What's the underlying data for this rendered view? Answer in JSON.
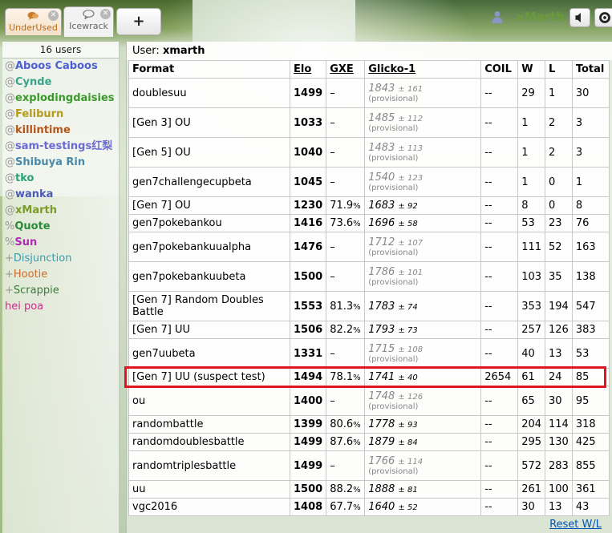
{
  "header": {
    "tabs": [
      {
        "label": "UnderUsed",
        "icon": "chat-bubbles-icon"
      },
      {
        "label": "Icewrack",
        "icon": "chat-bubble-icon"
      }
    ],
    "new_tab_label": "+",
    "username": "xMarth"
  },
  "users": {
    "count_label": "16 users",
    "items": [
      {
        "rank": "@",
        "name": "Aboos Caboos",
        "color": "#4d5fd3",
        "bold": true
      },
      {
        "rank": "@",
        "name": "Cynde",
        "color": "#3aa38a",
        "bold": true
      },
      {
        "rank": "@",
        "name": "explodingdaisies",
        "color": "#3a9a2a",
        "bold": true
      },
      {
        "rank": "@",
        "name": "Feliburn",
        "color": "#b59a1c",
        "bold": true
      },
      {
        "rank": "@",
        "name": "killintime",
        "color": "#b4551a",
        "bold": true
      },
      {
        "rank": "@",
        "name": "sam-testings红梨",
        "color": "#6a6ad0",
        "bold": true
      },
      {
        "rank": "@",
        "name": "Shibuya Rin",
        "color": "#4a8aa8",
        "bold": true
      },
      {
        "rank": "@",
        "name": "tko",
        "color": "#2aa07a",
        "bold": true
      },
      {
        "rank": "@",
        "name": "wanka",
        "color": "#4a5ab5",
        "bold": true
      },
      {
        "rank": "@",
        "name": "xMarth",
        "color": "#7a9a2a",
        "bold": true
      },
      {
        "rank": "%",
        "name": "Quote",
        "color": "#2a8a3a",
        "bold": true
      },
      {
        "rank": "%",
        "name": "Sun",
        "color": "#b02ab5",
        "bold": true
      },
      {
        "rank": "+",
        "name": "Disjunction",
        "color": "#3a9ab0",
        "bold": false
      },
      {
        "rank": "+",
        "name": "Hootie",
        "color": "#d06a2a",
        "bold": false
      },
      {
        "rank": "+",
        "name": "Scrappie",
        "color": "#3a7a3a",
        "bold": false
      },
      {
        "rank": "",
        "name": "hei poa",
        "color": "#d02a8a",
        "bold": false
      }
    ]
  },
  "main": {
    "user_label": "User:",
    "user_value": "xmarth",
    "columns": [
      "Format",
      "Elo",
      "GXE",
      "Glicko-1",
      "COIL",
      "W",
      "L",
      "Total"
    ],
    "provisional_label": "(provisional)",
    "rows": [
      {
        "format": "doublesuu",
        "elo": "1499",
        "gxe": "–",
        "gl": "1843",
        "rd": "± 161",
        "prov": true,
        "coil": "--",
        "w": "29",
        "l": "1",
        "total": "30"
      },
      {
        "format": "[Gen 3] OU",
        "elo": "1033",
        "gxe": "–",
        "gl": "1485",
        "rd": "± 112",
        "prov": true,
        "coil": "--",
        "w": "1",
        "l": "2",
        "total": "3"
      },
      {
        "format": "[Gen 5] OU",
        "elo": "1040",
        "gxe": "–",
        "gl": "1483",
        "rd": "± 113",
        "prov": true,
        "coil": "--",
        "w": "1",
        "l": "2",
        "total": "3"
      },
      {
        "format": "gen7challengecupbeta",
        "elo": "1045",
        "gxe": "–",
        "gl": "1540",
        "rd": "± 123",
        "prov": true,
        "coil": "--",
        "w": "1",
        "l": "0",
        "total": "1"
      },
      {
        "format": "[Gen 7] OU",
        "elo": "1230",
        "gxe": "71.9",
        "gl": "1683",
        "rd": "± 92",
        "prov": false,
        "coil": "--",
        "w": "8",
        "l": "0",
        "total": "8"
      },
      {
        "format": "gen7pokebankou",
        "elo": "1416",
        "gxe": "73.6",
        "gl": "1696",
        "rd": "± 58",
        "prov": false,
        "coil": "--",
        "w": "53",
        "l": "23",
        "total": "76"
      },
      {
        "format": "gen7pokebankuualpha",
        "elo": "1476",
        "gxe": "–",
        "gl": "1712",
        "rd": "± 107",
        "prov": true,
        "coil": "--",
        "w": "111",
        "l": "52",
        "total": "163"
      },
      {
        "format": "gen7pokebankuubeta",
        "elo": "1500",
        "gxe": "–",
        "gl": "1786",
        "rd": "± 101",
        "prov": true,
        "coil": "--",
        "w": "103",
        "l": "35",
        "total": "138"
      },
      {
        "format": "[Gen 7] Random Doubles Battle",
        "elo": "1553",
        "gxe": "81.3",
        "gl": "1783",
        "rd": "± 74",
        "prov": false,
        "coil": "--",
        "w": "353",
        "l": "194",
        "total": "547"
      },
      {
        "format": "[Gen 7] UU",
        "elo": "1506",
        "gxe": "82.2",
        "gl": "1793",
        "rd": "± 73",
        "prov": false,
        "coil": "--",
        "w": "257",
        "l": "126",
        "total": "383"
      },
      {
        "format": "gen7uubeta",
        "elo": "1331",
        "gxe": "–",
        "gl": "1715",
        "rd": "± 108",
        "prov": true,
        "coil": "--",
        "w": "40",
        "l": "13",
        "total": "53"
      },
      {
        "format": "[Gen 7] UU (suspect test)",
        "elo": "1494",
        "gxe": "78.1",
        "gl": "1741",
        "rd": "± 40",
        "prov": false,
        "coil": "2654",
        "w": "61",
        "l": "24",
        "total": "85",
        "highlighted": true
      },
      {
        "format": "ou",
        "elo": "1400",
        "gxe": "–",
        "gl": "1748",
        "rd": "± 126",
        "prov": true,
        "coil": "--",
        "w": "65",
        "l": "30",
        "total": "95"
      },
      {
        "format": "randombattle",
        "elo": "1399",
        "gxe": "80.6",
        "gl": "1778",
        "rd": "± 93",
        "prov": false,
        "coil": "--",
        "w": "204",
        "l": "114",
        "total": "318"
      },
      {
        "format": "randomdoublesbattle",
        "elo": "1499",
        "gxe": "87.6",
        "gl": "1879",
        "rd": "± 84",
        "prov": false,
        "coil": "--",
        "w": "295",
        "l": "130",
        "total": "425"
      },
      {
        "format": "randomtriplesbattle",
        "elo": "1499",
        "gxe": "–",
        "gl": "1766",
        "rd": "± 114",
        "prov": true,
        "coil": "--",
        "w": "572",
        "l": "283",
        "total": "855"
      },
      {
        "format": "uu",
        "elo": "1500",
        "gxe": "88.2",
        "gl": "1888",
        "rd": "± 81",
        "prov": false,
        "coil": "--",
        "w": "261",
        "l": "100",
        "total": "361"
      },
      {
        "format": "vgc2016",
        "elo": "1408",
        "gxe": "67.7",
        "gl": "1640",
        "rd": "± 52",
        "prov": false,
        "coil": "--",
        "w": "30",
        "l": "13",
        "total": "43"
      }
    ],
    "reset_label": "Reset W/L"
  },
  "colors": {
    "highlight": "#e0171f",
    "link": "#0053b3"
  }
}
